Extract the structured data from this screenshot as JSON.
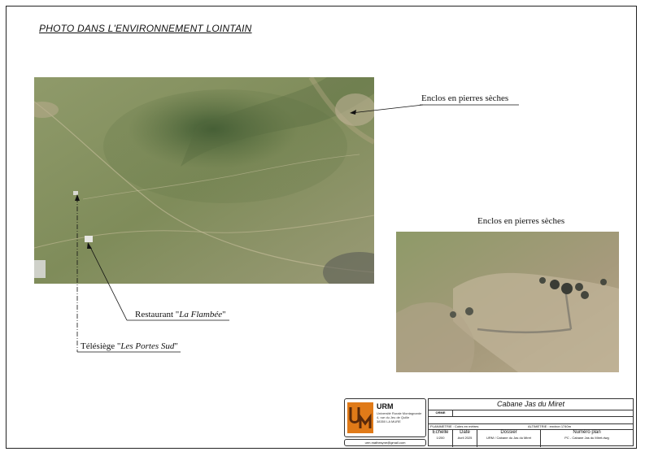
{
  "page_title": "PHOTO DANS L'ENVIRONNEMENT LOINTAIN",
  "labels": {
    "enclos_top": "Enclos en pierres sèches",
    "enclos_photo": "Enclos en pierres sèches",
    "restaurant_prefix": "Restaurant \"",
    "restaurant_name": "La Flambée",
    "restaurant_suffix": "\"",
    "telesiege_prefix": "Télésiège \"",
    "telesiege_name": "Les Portes Sud",
    "telesiege_suffix": "\""
  },
  "cartouche": {
    "logo_name": "URM",
    "logo_lines": [
      "Université Rurale Montagnarde",
      "4, rue du Jeu de Quille",
      "38350 LA MURE"
    ],
    "email": "urm.mathesyne@gmail.com",
    "project_title": "Cabane Jas du Miret",
    "orme_label": "ORME",
    "planimetrie": "PLANIMETRIE : Cotes en mètres",
    "altimetrie": "ALTIMETRIE : environ 1740m",
    "echelle_h": "Echelle",
    "echelle_v": "1/200",
    "date_h": "Date",
    "date_v": "Avril 2025",
    "dossier_h": "Dossier",
    "dossier_v": "URM / Cabane du Jas du Miret",
    "numero_h": "Numéro plan",
    "numero_v": "PC - Cabane Jas du Miret.dwg"
  },
  "colors": {
    "accent_logo": "#e07a18",
    "terrain_green": "#7c8a58",
    "terrain_rock": "#b9ab92"
  }
}
